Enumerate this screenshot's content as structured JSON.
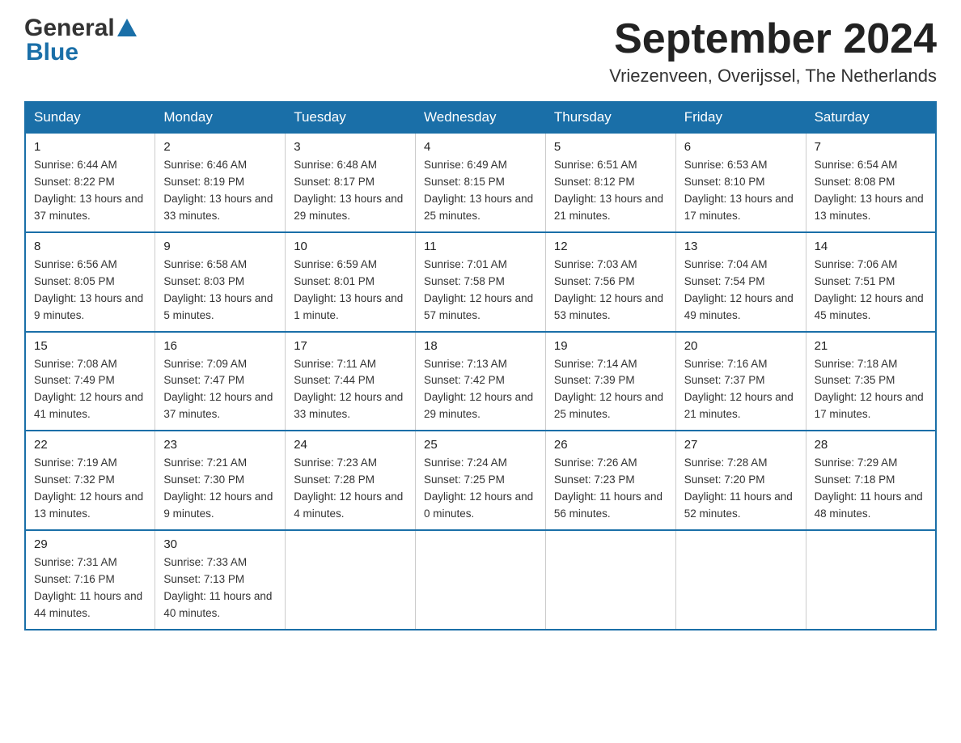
{
  "header": {
    "logo_general": "General",
    "logo_blue": "Blue",
    "month_title": "September 2024",
    "subtitle": "Vriezenveen, Overijssel, The Netherlands"
  },
  "days_of_week": [
    "Sunday",
    "Monday",
    "Tuesday",
    "Wednesday",
    "Thursday",
    "Friday",
    "Saturday"
  ],
  "weeks": [
    [
      {
        "day": "1",
        "sunrise": "Sunrise: 6:44 AM",
        "sunset": "Sunset: 8:22 PM",
        "daylight": "Daylight: 13 hours and 37 minutes."
      },
      {
        "day": "2",
        "sunrise": "Sunrise: 6:46 AM",
        "sunset": "Sunset: 8:19 PM",
        "daylight": "Daylight: 13 hours and 33 minutes."
      },
      {
        "day": "3",
        "sunrise": "Sunrise: 6:48 AM",
        "sunset": "Sunset: 8:17 PM",
        "daylight": "Daylight: 13 hours and 29 minutes."
      },
      {
        "day": "4",
        "sunrise": "Sunrise: 6:49 AM",
        "sunset": "Sunset: 8:15 PM",
        "daylight": "Daylight: 13 hours and 25 minutes."
      },
      {
        "day": "5",
        "sunrise": "Sunrise: 6:51 AM",
        "sunset": "Sunset: 8:12 PM",
        "daylight": "Daylight: 13 hours and 21 minutes."
      },
      {
        "day": "6",
        "sunrise": "Sunrise: 6:53 AM",
        "sunset": "Sunset: 8:10 PM",
        "daylight": "Daylight: 13 hours and 17 minutes."
      },
      {
        "day": "7",
        "sunrise": "Sunrise: 6:54 AM",
        "sunset": "Sunset: 8:08 PM",
        "daylight": "Daylight: 13 hours and 13 minutes."
      }
    ],
    [
      {
        "day": "8",
        "sunrise": "Sunrise: 6:56 AM",
        "sunset": "Sunset: 8:05 PM",
        "daylight": "Daylight: 13 hours and 9 minutes."
      },
      {
        "day": "9",
        "sunrise": "Sunrise: 6:58 AM",
        "sunset": "Sunset: 8:03 PM",
        "daylight": "Daylight: 13 hours and 5 minutes."
      },
      {
        "day": "10",
        "sunrise": "Sunrise: 6:59 AM",
        "sunset": "Sunset: 8:01 PM",
        "daylight": "Daylight: 13 hours and 1 minute."
      },
      {
        "day": "11",
        "sunrise": "Sunrise: 7:01 AM",
        "sunset": "Sunset: 7:58 PM",
        "daylight": "Daylight: 12 hours and 57 minutes."
      },
      {
        "day": "12",
        "sunrise": "Sunrise: 7:03 AM",
        "sunset": "Sunset: 7:56 PM",
        "daylight": "Daylight: 12 hours and 53 minutes."
      },
      {
        "day": "13",
        "sunrise": "Sunrise: 7:04 AM",
        "sunset": "Sunset: 7:54 PM",
        "daylight": "Daylight: 12 hours and 49 minutes."
      },
      {
        "day": "14",
        "sunrise": "Sunrise: 7:06 AM",
        "sunset": "Sunset: 7:51 PM",
        "daylight": "Daylight: 12 hours and 45 minutes."
      }
    ],
    [
      {
        "day": "15",
        "sunrise": "Sunrise: 7:08 AM",
        "sunset": "Sunset: 7:49 PM",
        "daylight": "Daylight: 12 hours and 41 minutes."
      },
      {
        "day": "16",
        "sunrise": "Sunrise: 7:09 AM",
        "sunset": "Sunset: 7:47 PM",
        "daylight": "Daylight: 12 hours and 37 minutes."
      },
      {
        "day": "17",
        "sunrise": "Sunrise: 7:11 AM",
        "sunset": "Sunset: 7:44 PM",
        "daylight": "Daylight: 12 hours and 33 minutes."
      },
      {
        "day": "18",
        "sunrise": "Sunrise: 7:13 AM",
        "sunset": "Sunset: 7:42 PM",
        "daylight": "Daylight: 12 hours and 29 minutes."
      },
      {
        "day": "19",
        "sunrise": "Sunrise: 7:14 AM",
        "sunset": "Sunset: 7:39 PM",
        "daylight": "Daylight: 12 hours and 25 minutes."
      },
      {
        "day": "20",
        "sunrise": "Sunrise: 7:16 AM",
        "sunset": "Sunset: 7:37 PM",
        "daylight": "Daylight: 12 hours and 21 minutes."
      },
      {
        "day": "21",
        "sunrise": "Sunrise: 7:18 AM",
        "sunset": "Sunset: 7:35 PM",
        "daylight": "Daylight: 12 hours and 17 minutes."
      }
    ],
    [
      {
        "day": "22",
        "sunrise": "Sunrise: 7:19 AM",
        "sunset": "Sunset: 7:32 PM",
        "daylight": "Daylight: 12 hours and 13 minutes."
      },
      {
        "day": "23",
        "sunrise": "Sunrise: 7:21 AM",
        "sunset": "Sunset: 7:30 PM",
        "daylight": "Daylight: 12 hours and 9 minutes."
      },
      {
        "day": "24",
        "sunrise": "Sunrise: 7:23 AM",
        "sunset": "Sunset: 7:28 PM",
        "daylight": "Daylight: 12 hours and 4 minutes."
      },
      {
        "day": "25",
        "sunrise": "Sunrise: 7:24 AM",
        "sunset": "Sunset: 7:25 PM",
        "daylight": "Daylight: 12 hours and 0 minutes."
      },
      {
        "day": "26",
        "sunrise": "Sunrise: 7:26 AM",
        "sunset": "Sunset: 7:23 PM",
        "daylight": "Daylight: 11 hours and 56 minutes."
      },
      {
        "day": "27",
        "sunrise": "Sunrise: 7:28 AM",
        "sunset": "Sunset: 7:20 PM",
        "daylight": "Daylight: 11 hours and 52 minutes."
      },
      {
        "day": "28",
        "sunrise": "Sunrise: 7:29 AM",
        "sunset": "Sunset: 7:18 PM",
        "daylight": "Daylight: 11 hours and 48 minutes."
      }
    ],
    [
      {
        "day": "29",
        "sunrise": "Sunrise: 7:31 AM",
        "sunset": "Sunset: 7:16 PM",
        "daylight": "Daylight: 11 hours and 44 minutes."
      },
      {
        "day": "30",
        "sunrise": "Sunrise: 7:33 AM",
        "sunset": "Sunset: 7:13 PM",
        "daylight": "Daylight: 11 hours and 40 minutes."
      },
      null,
      null,
      null,
      null,
      null
    ]
  ]
}
